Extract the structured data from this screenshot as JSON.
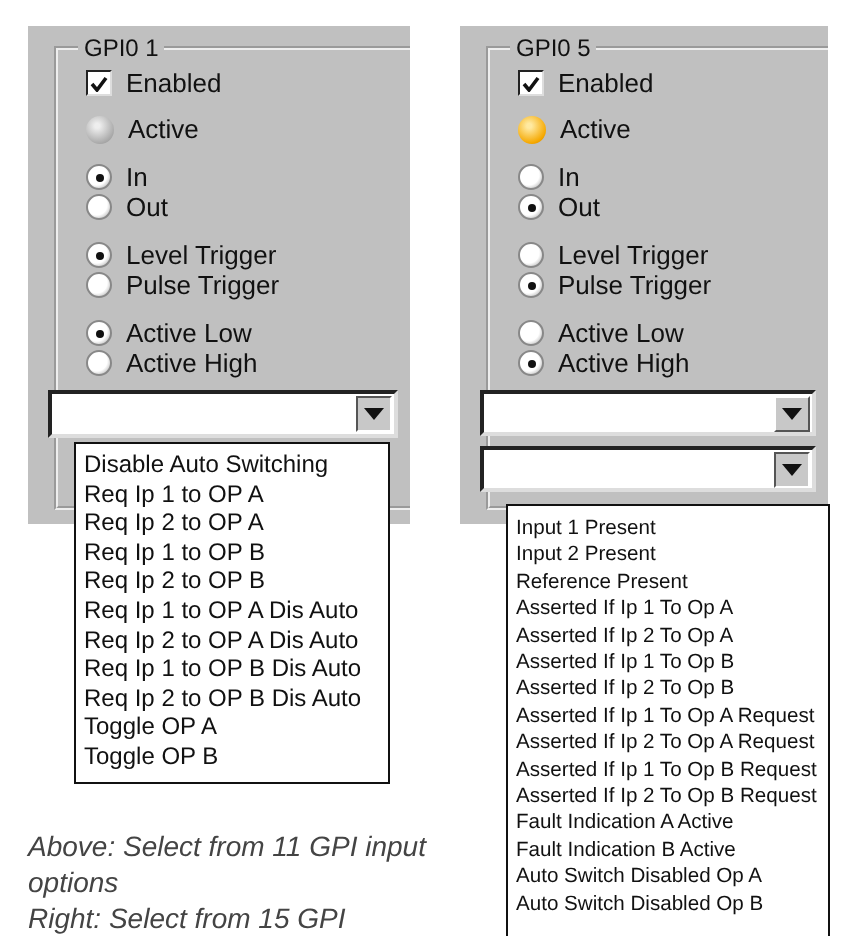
{
  "panels": [
    {
      "title": "GPI0 1",
      "enabled": {
        "label": "Enabled",
        "checked": true
      },
      "active": {
        "label": "Active",
        "on": false
      },
      "radio_groups": [
        [
          {
            "label": "In",
            "selected": true
          },
          {
            "label": "Out",
            "selected": false
          }
        ],
        [
          {
            "label": "Level Trigger",
            "selected": true
          },
          {
            "label": "Pulse Trigger",
            "selected": false
          }
        ],
        [
          {
            "label": "Active Low",
            "selected": true
          },
          {
            "label": "Active High",
            "selected": false
          }
        ]
      ],
      "dropdowns": [
        {
          "expanded": true,
          "options": [
            "Disable Auto Switching",
            "Req Ip 1 to OP A",
            "Req Ip 2 to OP A",
            "Req Ip 1 to OP B",
            "Req Ip 2 to OP B",
            "Req Ip 1 to OP A Dis Auto",
            "Req Ip 2 to OP A Dis Auto",
            "Req Ip 1 to OP B Dis Auto",
            "Req Ip 2 to OP B Dis Auto",
            "Toggle OP A",
            "Toggle OP B"
          ]
        }
      ]
    },
    {
      "title": "GPI0 5",
      "enabled": {
        "label": "Enabled",
        "checked": true
      },
      "active": {
        "label": "Active",
        "on": true
      },
      "radio_groups": [
        [
          {
            "label": "In",
            "selected": false
          },
          {
            "label": "Out",
            "selected": true
          }
        ],
        [
          {
            "label": "Level Trigger",
            "selected": false
          },
          {
            "label": "Pulse Trigger",
            "selected": true
          }
        ],
        [
          {
            "label": "Active Low",
            "selected": false
          },
          {
            "label": "Active High",
            "selected": true
          }
        ]
      ],
      "dropdowns": [
        {
          "expanded": false
        },
        {
          "expanded": true,
          "options": [
            "Input 1 Present",
            "Input 2 Present",
            "Reference Present",
            "Asserted If Ip 1 To Op A",
            "Asserted If Ip 2 To Op A",
            "Asserted If Ip 1 To Op B",
            "Asserted If Ip 2 To Op B",
            "Asserted If Ip 1 To Op A Request",
            "Asserted If Ip 2 To Op A Request",
            "Asserted If Ip 1 To Op B Request",
            "Asserted If Ip 2 To Op B Request",
            "Fault Indication A Active",
            "Fault Indication B Active",
            "Auto Switch Disabled Op A",
            "Auto Switch Disabled Op B"
          ]
        }
      ]
    }
  ],
  "captions": [
    "Above: Select from 11 GPI input options",
    "Right: Select from 15 GPI"
  ]
}
